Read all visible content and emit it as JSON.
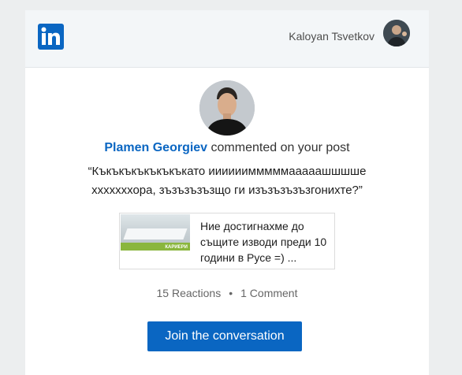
{
  "header": {
    "logo_label": "in",
    "recipient_name": "Kaloyan Tsvetkov"
  },
  "notification": {
    "actor_name": "Plamen Georgiev",
    "action_text": " commented on your post",
    "comment_text": "“Къкъкъкъкъкъкъкато иииииимммммааааашшшше хххххххора, зъзъзъзъзщо ги изъзъзъзъзгонихте?”"
  },
  "shared_post": {
    "text": "Ние достигнахме до същите изводи преди 10 години в Русе =) ...",
    "thumb_tag": "КАРИЕРИ"
  },
  "stats": {
    "reactions": "15 Reactions",
    "separator": "•",
    "comments": "1 Comment"
  },
  "cta": {
    "label": "Join the conversation"
  },
  "colors": {
    "brand": "#0a66c2",
    "header_bg": "#f3f6f8",
    "page_bg": "#eceeef"
  }
}
